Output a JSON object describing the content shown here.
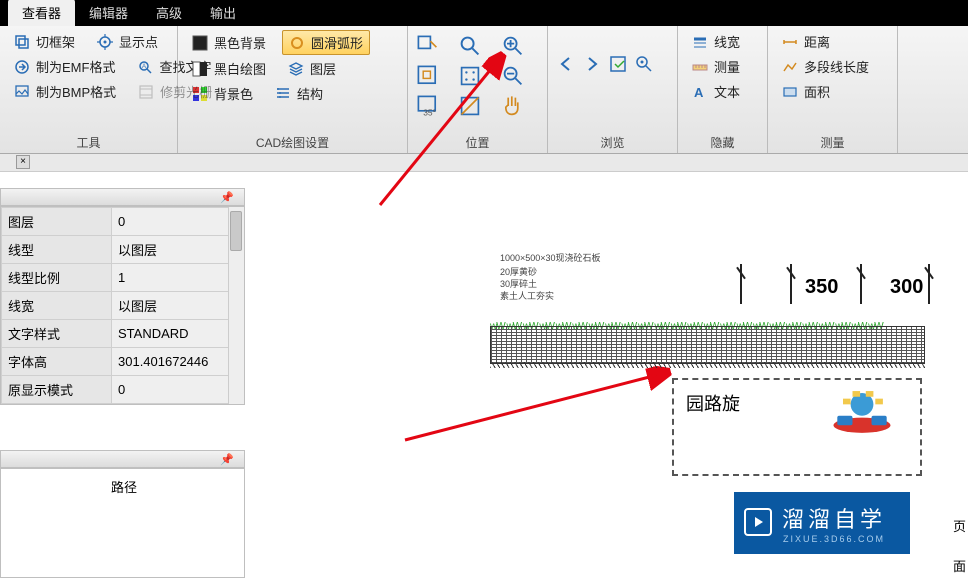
{
  "tabs": {
    "viewer": "查看器",
    "editor": "编辑器",
    "advanced": "高级",
    "output": "输出"
  },
  "ribbon": {
    "tools": {
      "cut_frame": "切框架",
      "display_point": "显示点",
      "to_emf": "制为EMF格式",
      "find_text": "查找文字",
      "to_bmp": "制为BMP格式",
      "trim_raster": "修剪光栅",
      "title": "工具"
    },
    "cad": {
      "black_bg": "黑色背景",
      "smooth_arc": "圆滑弧形",
      "bw_draw": "黑白绘图",
      "layer": "图层",
      "bg_color": "背景色",
      "structure": "结构",
      "title": "CAD绘图设置"
    },
    "position": {
      "title": "位置"
    },
    "browse": {
      "title": "浏览"
    },
    "hide": {
      "linewidth": "线宽",
      "measure": "测量",
      "text": "文本",
      "title": "隐藏"
    },
    "measure": {
      "distance": "距离",
      "polyline": "多段线长度",
      "area": "面积",
      "title": "测量"
    }
  },
  "props": {
    "rows": [
      {
        "k": "图层",
        "v": "0"
      },
      {
        "k": "线型",
        "v": "以图层"
      },
      {
        "k": "线型比例",
        "v": "1"
      },
      {
        "k": "线宽",
        "v": "以图层"
      },
      {
        "k": "文字样式",
        "v": "STANDARD"
      },
      {
        "k": "字体高",
        "v": "301.401672446"
      },
      {
        "k": "原显示模式",
        "v": "0"
      }
    ]
  },
  "panel2": {
    "path_label": "路径"
  },
  "drawing": {
    "spec": "1000×500×30现浇砼石板",
    "line1": "20厚黄砂",
    "line2": "30厚碎土",
    "line3": "素土人工夯实",
    "dim1": "350",
    "dim2": "300",
    "callout": "园路旋"
  },
  "badge": {
    "main": "溜溜自学",
    "sub": "ZIXUE.3D66.COM"
  },
  "side": {
    "a": "页",
    "b": "面"
  }
}
